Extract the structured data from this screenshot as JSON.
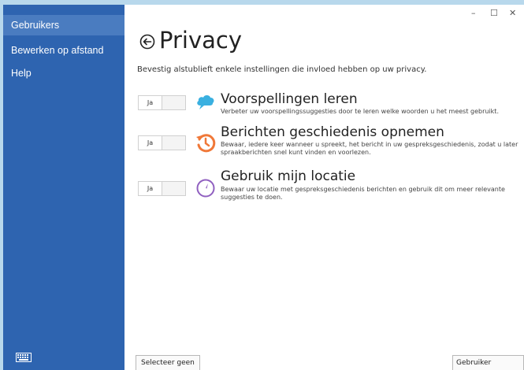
{
  "sidebar": {
    "items": [
      {
        "label": "Gebruikers"
      },
      {
        "label": "Bewerken op afstand"
      },
      {
        "label": "Help"
      }
    ]
  },
  "window_controls": {
    "minimize": "–",
    "maximize": "☐",
    "close": "✕"
  },
  "header": {
    "title": "Privacy",
    "subtitle": "Bevestig alstublieft enkele instellingen die invloed hebben op uw privacy."
  },
  "options": [
    {
      "toggle_label": "Ja",
      "icon": "cloud-icon",
      "icon_color": "#3ab0e0",
      "title": "Voorspellingen leren",
      "description": "Verbeter uw voorspellingssuggesties door te leren welke woorden u het meest gebruikt."
    },
    {
      "toggle_label": "Ja",
      "icon": "history-icon",
      "icon_color": "#f07838",
      "title": "Berichten geschiedenis opnemen",
      "description": "Bewaar, iedere keer wanneer u spreekt, het bericht in uw gespreksgeschiedenis, zodat u later spraakberichten snel kunt vinden en voorlezen."
    },
    {
      "toggle_label": "Ja",
      "icon": "compass-icon",
      "icon_color": "#9060c0",
      "title": "Gebruik mijn locatie",
      "description": "Bewaar uw locatie met gespreksgeschiedenis berichten en gebruik dit om meer relevante suggesties te doen."
    }
  ],
  "footer": {
    "select_none": "Selecteer geen",
    "create_user": "Gebruiker creëren"
  },
  "colors": {
    "sidebar": "#2e64b0",
    "sidebar_active": "#4a7cc0",
    "background": "#b8d8ec"
  }
}
